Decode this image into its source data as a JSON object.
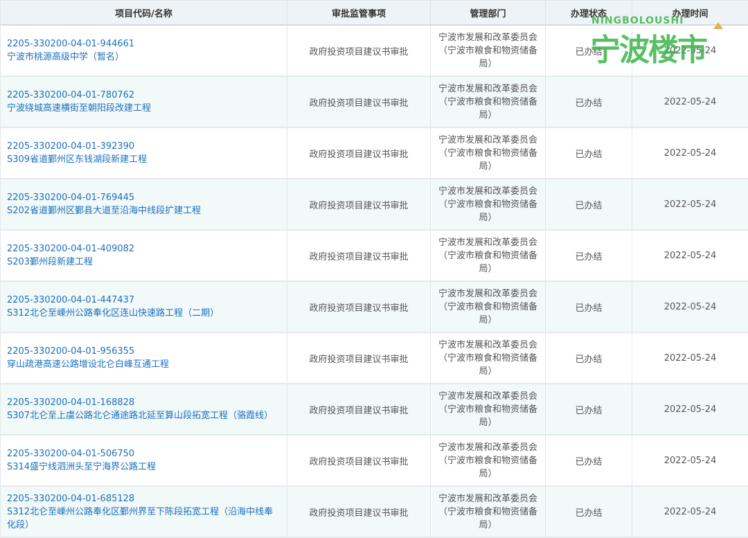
{
  "headers": {
    "code_name": "项目代码/名称",
    "matter": "审批监管事项",
    "dept": "管理部门",
    "status": "办理状态",
    "time": "办理时间"
  },
  "rows": [
    {
      "code": "2205-330200-04-01-944661",
      "name": "宁波市桃源高级中学（暂名）",
      "matter": "政府投资项目建议书审批",
      "dept": "宁波市发展和改革委员会（宁波市粮食和物资储备局）",
      "status": "已办结",
      "time": "2022-05-24"
    },
    {
      "code": "2205-330200-04-01-780762",
      "name": "宁波绕城高速横街至朝阳段改建工程",
      "matter": "政府投资项目建议书审批",
      "dept": "宁波市发展和改革委员会（宁波市粮食和物资储备局）",
      "status": "已办结",
      "time": "2022-05-24"
    },
    {
      "code": "2205-330200-04-01-392390",
      "name": "S309省道鄞州区东钱湖段新建工程",
      "matter": "政府投资项目建议书审批",
      "dept": "宁波市发展和改革委员会（宁波市粮食和物资储备局）",
      "status": "已办结",
      "time": "2022-05-24"
    },
    {
      "code": "2205-330200-04-01-769445",
      "name": "S202省道鄞州区鄞县大道至沿海中线段扩建工程",
      "matter": "政府投资项目建议书审批",
      "dept": "宁波市发展和改革委员会（宁波市粮食和物资储备局）",
      "status": "已办结",
      "time": "2022-05-24"
    },
    {
      "code": "2205-330200-04-01-409082",
      "name": "S203鄞州段新建工程",
      "matter": "政府投资项目建议书审批",
      "dept": "宁波市发展和改革委员会（宁波市粮食和物资储备局）",
      "status": "已办结",
      "time": "2022-05-24"
    },
    {
      "code": "2205-330200-04-01-447437",
      "name": "S312北仑至嵊州公路奉化区连山快速路工程（二期）",
      "matter": "政府投资项目建议书审批",
      "dept": "宁波市发展和改革委员会（宁波市粮食和物资储备局）",
      "status": "已办结",
      "time": "2022-05-24"
    },
    {
      "code": "2205-330200-04-01-956355",
      "name": "穿山疏港高速公路增设北仑白峰互通工程",
      "matter": "政府投资项目建议书审批",
      "dept": "宁波市发展和改革委员会（宁波市粮食和物资储备局）",
      "status": "已办结",
      "time": "2022-05-24"
    },
    {
      "code": "2205-330200-04-01-168828",
      "name": "S307北仑至上虞公路北仑通途路北延至算山段拓宽工程（骆霞线）",
      "matter": "政府投资项目建议书审批",
      "dept": "宁波市发展和改革委员会（宁波市粮食和物资储备局）",
      "status": "已办结",
      "time": "2022-05-24"
    },
    {
      "code": "2205-330200-04-01-506750",
      "name": "S314盛宁线泗洲头至宁海界公路工程",
      "matter": "政府投资项目建议书审批",
      "dept": "宁波市发展和改革委员会（宁波市粮食和物资储备局）",
      "status": "已办结",
      "time": "2022-05-24"
    },
    {
      "code": "2205-330200-04-01-685128",
      "name": "S312北仑至嵊州公路奉化区鄞州界至下陈段拓宽工程（沿海中线奉化段）",
      "matter": "政府投资项目建议书审批",
      "dept": "宁波市发展和改革委员会（宁波市粮食和物资储备局）",
      "status": "已办结",
      "time": "2022-05-24"
    }
  ],
  "watermark": {
    "latin": "NINGBOLOUSHI",
    "cn": "宁波楼市",
    "color": "#3bb54a",
    "accent": "#e8a53a"
  },
  "colors": {
    "link": "#1b6fbe",
    "header_bg": "#eef3f7",
    "alt_row_bg": "#f2f9f9"
  }
}
